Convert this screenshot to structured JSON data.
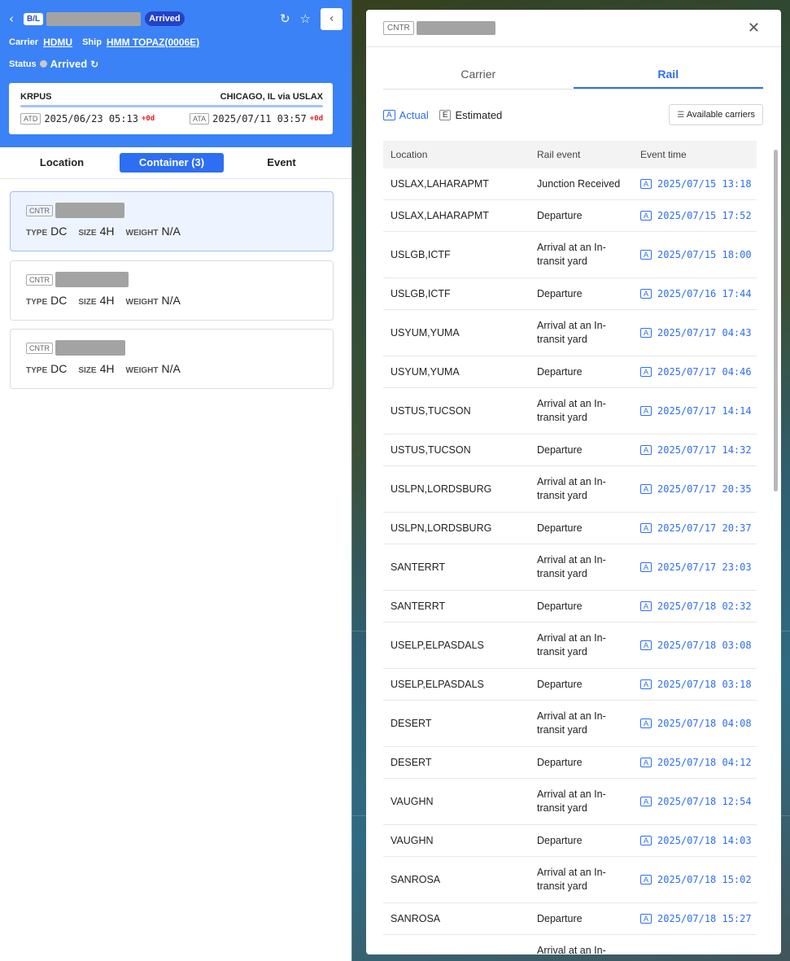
{
  "header": {
    "bl_tag": "B/L",
    "status_pill": "Arrived",
    "carrier_label": "Carrier",
    "carrier_value": "HDMU",
    "ship_label": "Ship",
    "ship_value": "HMM TOPAZ(0006E)",
    "status_label": "Status",
    "status_value": "Arrived"
  },
  "route": {
    "origin": "KRPUS",
    "destination": "CHICAGO, IL via USLAX",
    "atd_tag": "ATD",
    "atd_value": "2025/06/23 05:13",
    "atd_delta": "+0d",
    "ata_tag": "ATA",
    "ata_value": "2025/07/11 03:57",
    "ata_delta": "+0d"
  },
  "left_tabs": {
    "location": "Location",
    "container": "Container (3)",
    "event": "Event"
  },
  "containers": [
    {
      "tag": "CNTR",
      "type_label": "TYPE",
      "type": "DC",
      "size_label": "SIZE",
      "size": "4H",
      "weight_label": "WEIGHT",
      "weight": "N/A"
    },
    {
      "tag": "CNTR",
      "type_label": "TYPE",
      "type": "DC",
      "size_label": "SIZE",
      "size": "4H",
      "weight_label": "WEIGHT",
      "weight": "N/A"
    },
    {
      "tag": "CNTR",
      "type_label": "TYPE",
      "type": "DC",
      "size_label": "SIZE",
      "size": "4H",
      "weight_label": "WEIGHT",
      "weight": "N/A"
    }
  ],
  "modal": {
    "tag": "CNTR",
    "tab_carrier": "Carrier",
    "tab_rail": "Rail",
    "legend_actual_tag": "A",
    "legend_actual": "Actual",
    "legend_estimated_tag": "E",
    "legend_estimated": "Estimated",
    "available_carriers": "Available carriers",
    "col_location": "Location",
    "col_event": "Rail event",
    "col_time": "Event time"
  },
  "rail_events": [
    {
      "location": "USLAX,LAHARAPMT",
      "event": "Junction Received",
      "tag": "A",
      "time": "2025/07/15 13:18"
    },
    {
      "location": "USLAX,LAHARAPMT",
      "event": "Departure",
      "tag": "A",
      "time": "2025/07/15 17:52"
    },
    {
      "location": "USLGB,ICTF",
      "event": "Arrival at an In-transit yard",
      "tag": "A",
      "time": "2025/07/15 18:00"
    },
    {
      "location": "USLGB,ICTF",
      "event": "Departure",
      "tag": "A",
      "time": "2025/07/16 17:44"
    },
    {
      "location": "USYUM,YUMA",
      "event": "Arrival at an In-transit yard",
      "tag": "A",
      "time": "2025/07/17 04:43"
    },
    {
      "location": "USYUM,YUMA",
      "event": "Departure",
      "tag": "A",
      "time": "2025/07/17 04:46"
    },
    {
      "location": "USTUS,TUCSON",
      "event": "Arrival at an In-transit yard",
      "tag": "A",
      "time": "2025/07/17 14:14"
    },
    {
      "location": "USTUS,TUCSON",
      "event": "Departure",
      "tag": "A",
      "time": "2025/07/17 14:32"
    },
    {
      "location": "USLPN,LORDSBURG",
      "event": "Arrival at an In-transit yard",
      "tag": "A",
      "time": "2025/07/17 20:35"
    },
    {
      "location": "USLPN,LORDSBURG",
      "event": "Departure",
      "tag": "A",
      "time": "2025/07/17 20:37"
    },
    {
      "location": "SANTERRT",
      "event": "Arrival at an In-transit yard",
      "tag": "A",
      "time": "2025/07/17 23:03"
    },
    {
      "location": "SANTERRT",
      "event": "Departure",
      "tag": "A",
      "time": "2025/07/18 02:32"
    },
    {
      "location": "USELP,ELPASDALS",
      "event": "Arrival at an In-transit yard",
      "tag": "A",
      "time": "2025/07/18 03:08"
    },
    {
      "location": "USELP,ELPASDALS",
      "event": "Departure",
      "tag": "A",
      "time": "2025/07/18 03:18"
    },
    {
      "location": "DESERT",
      "event": "Arrival at an In-transit yard",
      "tag": "A",
      "time": "2025/07/18 04:08"
    },
    {
      "location": "DESERT",
      "event": "Departure",
      "tag": "A",
      "time": "2025/07/18 04:12"
    },
    {
      "location": "VAUGHN",
      "event": "Arrival at an In-transit yard",
      "tag": "A",
      "time": "2025/07/18 12:54"
    },
    {
      "location": "VAUGHN",
      "event": "Departure",
      "tag": "A",
      "time": "2025/07/18 14:03"
    },
    {
      "location": "SANROSA",
      "event": "Arrival at an In-transit yard",
      "tag": "A",
      "time": "2025/07/18 15:02"
    },
    {
      "location": "SANROSA",
      "event": "Departure",
      "tag": "A",
      "time": "2025/07/18 15:27"
    },
    {
      "location": "",
      "event": "Arrival at an In-",
      "tag": "",
      "time": ""
    }
  ]
}
